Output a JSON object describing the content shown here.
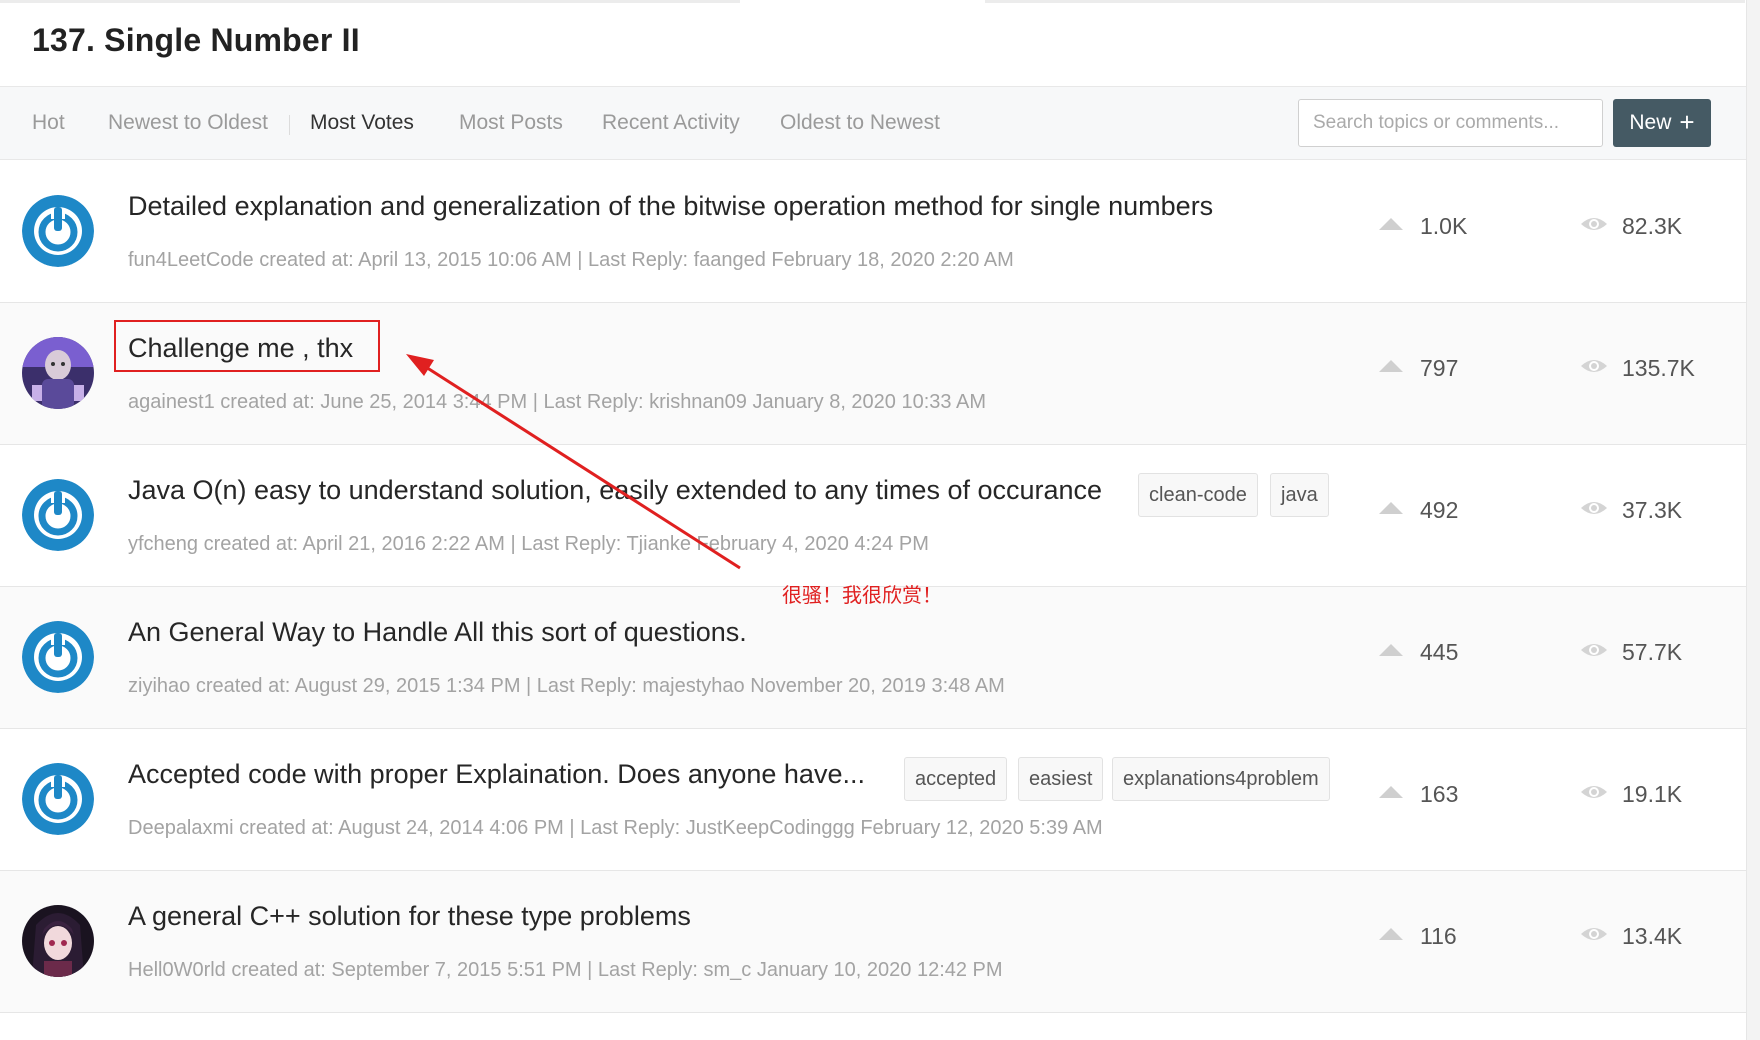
{
  "page": {
    "title": "137. Single Number II"
  },
  "toolbar": {
    "tabs": [
      {
        "label": "Hot"
      },
      {
        "label": "Newest to Oldest"
      },
      {
        "label": "Most Votes"
      },
      {
        "label": "Most Posts"
      },
      {
        "label": "Recent Activity"
      },
      {
        "label": "Oldest to Newest"
      }
    ],
    "active_tab": "Most Votes",
    "search_placeholder": "Search topics or comments...",
    "new_label": "New",
    "new_icon": "plus-icon"
  },
  "topics": [
    {
      "title": "Detailed explanation and generalization of the bitwise operation method for single numbers",
      "meta": "fun4LeetCode created at: April 13, 2015 10:06 AM | Last Reply: faanged February 18, 2020 2:20 AM",
      "tags": [],
      "votes": "1.0K",
      "views": "82.3K",
      "avatar": "power-icon-avatar"
    },
    {
      "title": "Challenge me , thx",
      "meta": "againest1 created at: June 25, 2014 3:44 PM | Last Reply: krishnan09 January 8, 2020 10:33 AM",
      "tags": [],
      "votes": "797",
      "views": "135.7K",
      "avatar": "character-avatar"
    },
    {
      "title": "Java O(n) easy to understand solution, easily extended to any times of occurance",
      "meta": "yfcheng created at: April 21, 2016 2:22 AM | Last Reply: Tjianke February 4, 2020 4:24 PM",
      "tags": [
        "clean-code",
        "java"
      ],
      "votes": "492",
      "views": "37.3K",
      "avatar": "power-icon-avatar"
    },
    {
      "title": "An General Way to Handle All this sort of questions.",
      "meta": "ziyihao created at: August 29, 2015 1:34 PM | Last Reply: majestyhao November 20, 2019 3:48 AM",
      "tags": [],
      "votes": "445",
      "views": "57.7K",
      "avatar": "power-icon-avatar"
    },
    {
      "title": "Accepted code with proper Explaination. Does anyone have...",
      "meta": "Deepalaxmi created at: August 24, 2014 4:06 PM | Last Reply: JustKeepCodinggg February 12, 2020 5:39 AM",
      "tags": [
        "accepted",
        "easiest",
        "explanations4problem"
      ],
      "votes": "163",
      "views": "19.1K",
      "avatar": "power-icon-avatar"
    },
    {
      "title": "A general C++ solution for these type problems",
      "meta": "Hell0W0rld created at: September 7, 2015 5:51 PM | Last Reply: sm_c January 10, 2020 12:42 PM",
      "tags": [],
      "votes": "116",
      "views": "13.4K",
      "avatar": "anime-avatar"
    }
  ],
  "annotation": {
    "text": "很骚！我很欣赏！",
    "color": "#e02020"
  },
  "colors": {
    "accent": "#1e88c7",
    "new_button": "#455a64",
    "annotation": "#e02020"
  }
}
